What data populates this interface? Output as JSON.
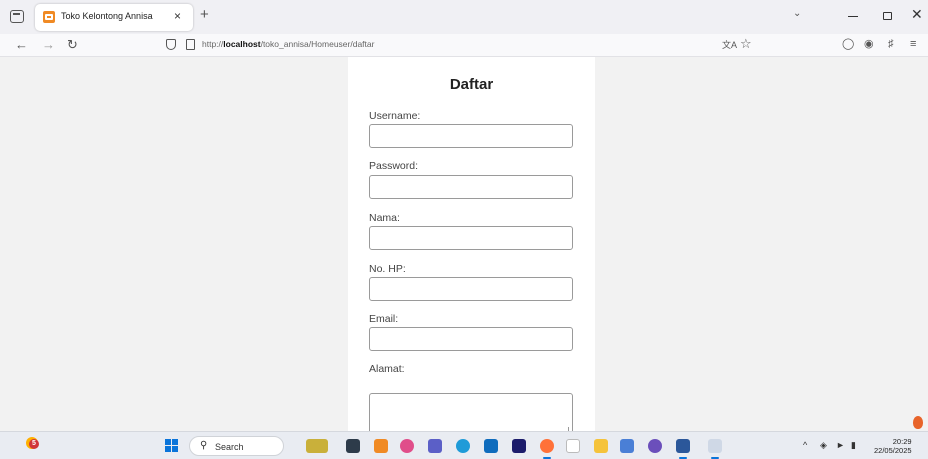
{
  "browser": {
    "tab": {
      "title": "Toko Kelontong Annisa",
      "close": "×"
    },
    "new_tab": "+",
    "url": {
      "prefix": "http://",
      "host": "localhost",
      "path": "/toko_annisa/Homeuser/daftar"
    },
    "icons": [
      "tab-list-icon",
      "back-arrow-icon",
      "forward-arrow-icon",
      "reload-icon",
      "shield-icon",
      "page-icon",
      "translate-icon",
      "star-icon",
      "pocket-icon",
      "account-icon",
      "extensions-icon",
      "menu-icon"
    ]
  },
  "form": {
    "title": "Daftar",
    "fields": [
      {
        "label": "Username:",
        "value": ""
      },
      {
        "label": "Password:",
        "value": ""
      },
      {
        "label": "Nama:",
        "value": ""
      },
      {
        "label": "No. HP:",
        "value": ""
      },
      {
        "label": "Email:",
        "value": ""
      },
      {
        "label": "Alamat:",
        "value": ""
      }
    ]
  },
  "taskbar": {
    "search_label": "Search",
    "weather_badge": "5",
    "clock_time": "20:29",
    "clock_date": "22/05/2025"
  },
  "colors": {
    "accent": "#0a74da",
    "favicon": "#f08a24",
    "page_bg": "#f2f2f2",
    "card_bg": "#ffffff"
  }
}
